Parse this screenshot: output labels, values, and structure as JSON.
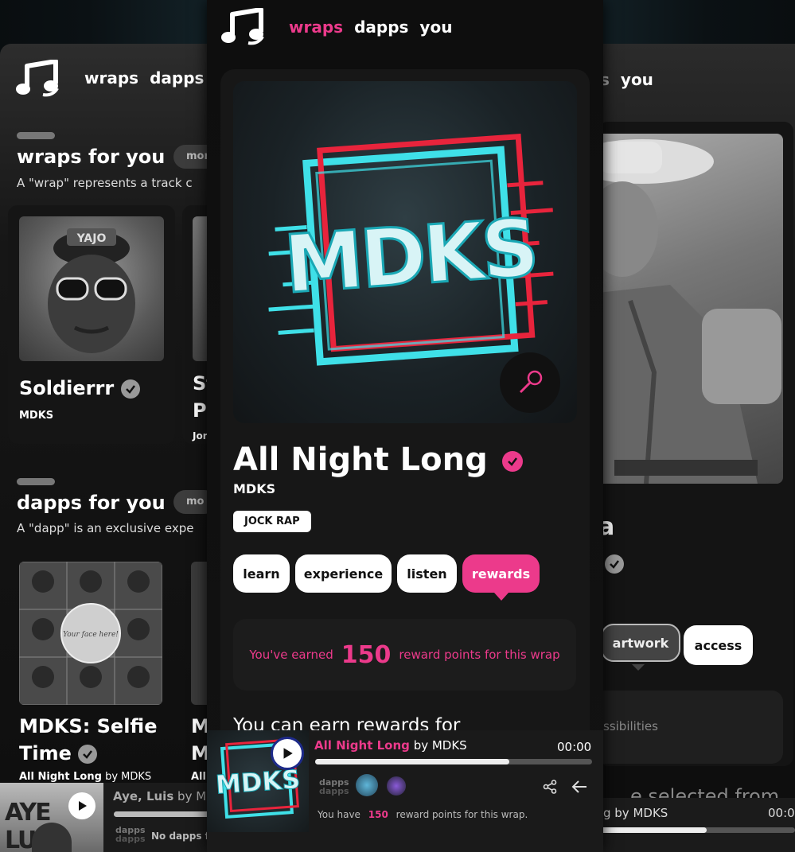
{
  "nav": {
    "wraps": "wraps",
    "dapps": "dapps",
    "you": "you"
  },
  "left": {
    "wraps_section": {
      "title": "wraps for you",
      "more": "more",
      "subtitle": "A \"wrap\" represents a track c"
    },
    "wrap_card": {
      "title": "Soldierrr",
      "artist": "MDKS",
      "cap_text": "YAJO"
    },
    "wrap_card2": {
      "title_l1": "St",
      "title_l2": "Pa",
      "artist": "Jor"
    },
    "dapps_section": {
      "title": "dapps for you",
      "more": "mo",
      "subtitle": "A \"dapp\" is an exclusive expe"
    },
    "dapp_card": {
      "title_l1": "MDKS: Selfie",
      "title_l2": "Time",
      "track": "All Night Long",
      "by": "by MDKS",
      "badge_text": "Your face here!"
    },
    "dapp_card2": {
      "title_l1": "M",
      "title_l2": "M",
      "track": "All"
    },
    "player": {
      "track": "Aye, Luis",
      "by": "by MD",
      "thumb_text": "AYE LUIS",
      "dapps_label": "dapps",
      "no_dapps": "No dapps fo"
    }
  },
  "center": {
    "cover_text": "MDKS",
    "title": "All Night Long",
    "artist": "MDKS",
    "genre": "JOCK RAP",
    "tabs": [
      "learn",
      "experience",
      "listen",
      "rewards"
    ],
    "rewards_text_before": "You've earned",
    "rewards_points": "150",
    "rewards_text_after": "reward points for this wrap",
    "earn_heading": "You can earn rewards for",
    "player": {
      "track": "All Night Long",
      "by": "by MDKS",
      "time": "00:00",
      "progress": 0.7,
      "dapps_label": "dapps",
      "thumb_text": "MDKS",
      "reward_before": "You have",
      "reward_points": "150",
      "reward_after": "reward points for this wrap."
    }
  },
  "right": {
    "nav_partial": "s",
    "you": "you",
    "title_partial": "a",
    "tabs": [
      "artwork",
      "access"
    ],
    "possibilities": "ssibilities",
    "selected_partial": "e selected from",
    "player": {
      "by": "g by MDKS",
      "time": "00:0"
    }
  },
  "colors": {
    "accent": "#ec3a8b",
    "cyan": "#3fe0e8",
    "red": "#e8243c"
  },
  "icons": {
    "logo": "music-notes-icon",
    "verified": "verified-check-icon",
    "mic": "microphone-icon",
    "play": "play-icon",
    "share": "share-icon",
    "back": "arrow-left-icon"
  }
}
